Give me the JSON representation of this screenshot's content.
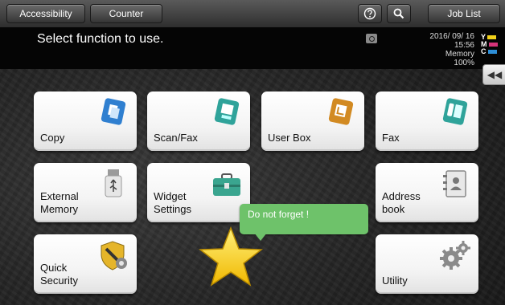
{
  "topbar": {
    "accessibility_label": "Accessibility",
    "counter_label": "Counter",
    "joblist_label": "Job List"
  },
  "message": "Select function to use.",
  "status": {
    "date": "2016/ 09/ 16",
    "time": "15:56",
    "memory_label": "Memory",
    "memory_value": "100%"
  },
  "toner": [
    {
      "letter": "Y",
      "color": "#f2d21a"
    },
    {
      "letter": "M",
      "color": "#d6347a"
    },
    {
      "letter": "C",
      "color": "#2e8fd8"
    }
  ],
  "sidetab_glyph": "◀◀",
  "tiles": {
    "copy": "Copy",
    "scan_fax": "Scan/Fax",
    "user_box": "User Box",
    "fax": "Fax",
    "external_memory": "External\nMemory",
    "widget_settings": "Widget\nSettings",
    "address_book": "Address\nbook",
    "quick_security": "Quick\nSecurity",
    "utility": "Utility"
  },
  "bubble_text": "Do not forget !",
  "colors": {
    "copy_icon": "#2f7fd0",
    "scanfax_icon": "#2fa39a",
    "userbox_icon": "#d28a22",
    "fax_icon": "#2fa39a",
    "bubble": "#6ec26a",
    "star": "#f5d32c"
  },
  "icons": [
    "help-icon",
    "search-icon",
    "copy-icon",
    "scan-fax-icon",
    "user-box-icon",
    "fax-icon",
    "usb-icon",
    "toolbox-icon",
    "address-book-icon",
    "shield-gear-icon",
    "gears-icon",
    "star-icon",
    "lock-icon"
  ]
}
